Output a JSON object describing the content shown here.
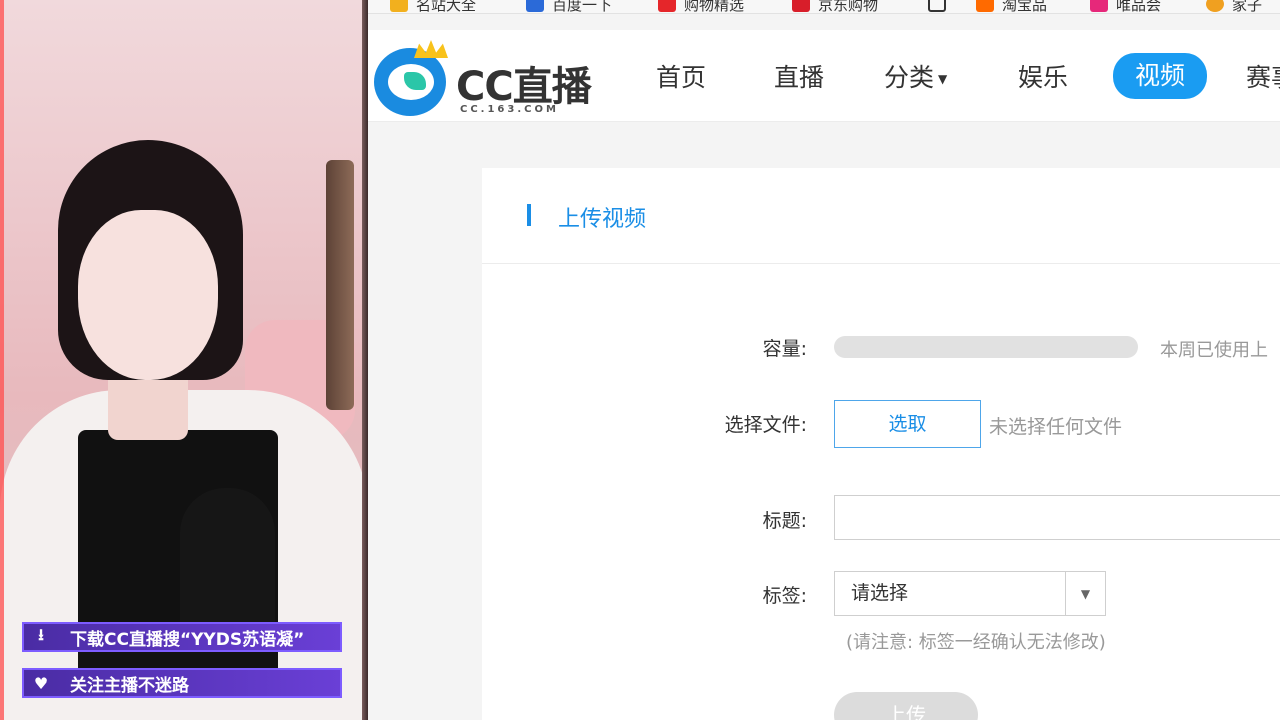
{
  "overlay": {
    "banner_download": "下载CC直播搜“YYDS苏语凝”",
    "banner_follow": "关注主播不迷路"
  },
  "bookmarks": [
    {
      "label": "名站大全",
      "color": "#f2b01e"
    },
    {
      "label": "百度一下",
      "color": "#2b6ad8"
    },
    {
      "label": "购物精选",
      "color": "#e5262a"
    },
    {
      "label": "京东购物",
      "color": "#d81e2a"
    },
    {
      "label": "",
      "color": "#333333"
    },
    {
      "label": "淘宝品",
      "color": "#ff6a00"
    },
    {
      "label": "唯品会",
      "color": "#e6287a"
    },
    {
      "label": "家子",
      "color": "#f0a020"
    }
  ],
  "site": {
    "logo_text": "CC直播",
    "logo_domain": "CC.163.COM",
    "nav": [
      "首页",
      "直播",
      "分类",
      "娱乐",
      "视频",
      "赛事"
    ],
    "active_nav": "视频"
  },
  "upload": {
    "section_title": "上传视频",
    "capacity_label": "容量:",
    "capacity_note": "本周已使用上",
    "file_label": "选择文件:",
    "pick_button": "选取",
    "file_status": "未选择任何文件",
    "title_label": "标题:",
    "title_value": "",
    "tag_label": "标签:",
    "tag_placeholder": "请选择",
    "tag_note": "(请注意: 标签一经确认无法修改)",
    "submit": "上传"
  },
  "colors": {
    "accent": "#1a9cf2",
    "banner": "#5a34c8"
  }
}
